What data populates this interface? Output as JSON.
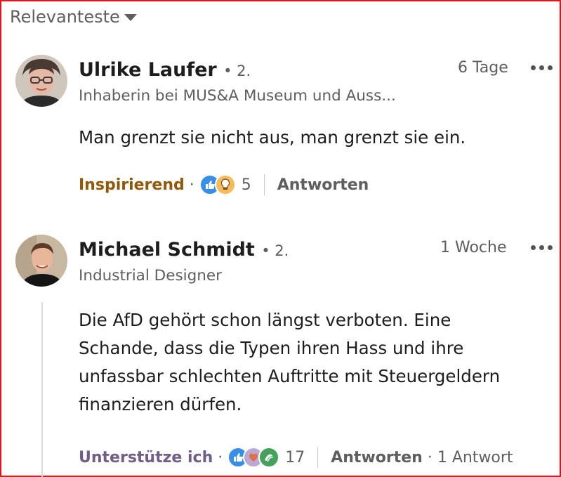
{
  "sort": {
    "label": "Relevanteste"
  },
  "comments": [
    {
      "author": "Ulrike Laufer",
      "degree": "• 2.",
      "headline": "Inhaberin bei MUS&A Museum und Auss...",
      "time": "6 Tage",
      "text": "Man grenzt sie nicht aus, man grenzt sie ein.",
      "reaction_label": "Inspirierend",
      "reaction_color": "#915907",
      "reaction_icons": [
        "like-icon",
        "insightful-icon"
      ],
      "reaction_count": "5",
      "reply_label": "Antworten"
    },
    {
      "author": "Michael Schmidt",
      "degree": "• 2.",
      "headline": "Industrial Designer",
      "time": "1 Woche",
      "text_lines": [
        "Die AfD gehört schon längst verboten. Eine",
        "Schande, dass die Typen ihren Hass und ihre",
        "unfassbar schlechten Auftritte mit Steuergeldern",
        "finanzieren dürfen."
      ],
      "reaction_label": "Unterstütze ich",
      "reaction_color": "#715e86",
      "reaction_icons": [
        "like-icon",
        "love-icon",
        "support-icon"
      ],
      "reaction_count": "17",
      "reply_label": "Antworten",
      "replies_sep": "·",
      "replies_count_label": "1 Antwort"
    }
  ]
}
